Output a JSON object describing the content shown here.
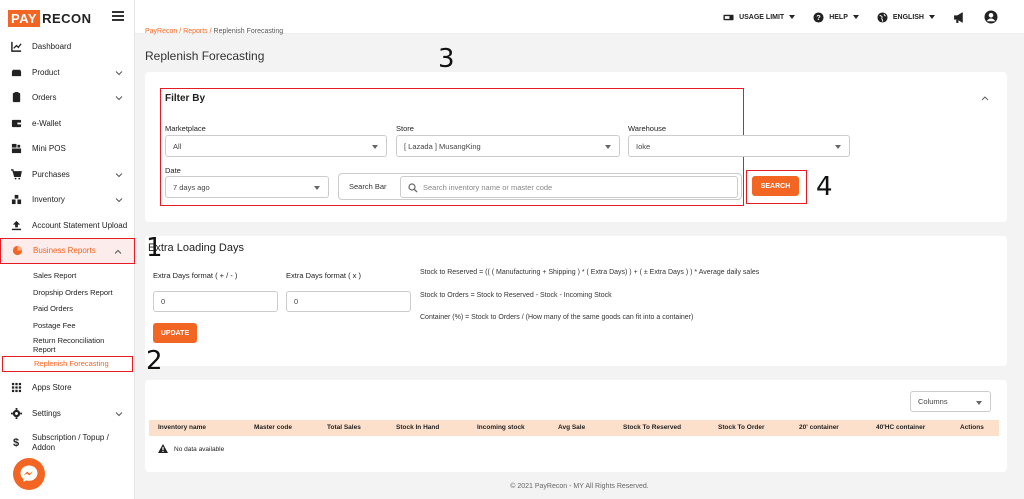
{
  "brand": {
    "logo_part1": "PAY",
    "logo_part2": "RECON"
  },
  "sidebar": {
    "items": [
      {
        "label": "Dashboard",
        "icon": "chart-icon"
      },
      {
        "label": "Product",
        "icon": "product-icon"
      },
      {
        "label": "Orders",
        "icon": "orders-icon"
      },
      {
        "label": "e-Wallet",
        "icon": "wallet-icon"
      },
      {
        "label": "Mini POS",
        "icon": "pos-icon"
      },
      {
        "label": "Purchases",
        "icon": "cart-icon"
      },
      {
        "label": "Inventory",
        "icon": "inventory-icon"
      },
      {
        "label": "Account Statement Upload",
        "icon": "upload-icon"
      },
      {
        "label": "Business Reports",
        "icon": "pie-icon"
      }
    ],
    "sub_items": [
      {
        "label": "Sales Report"
      },
      {
        "label": "Dropship Orders Report"
      },
      {
        "label": "Paid Orders"
      },
      {
        "label": "Postage Fee"
      },
      {
        "label": "Return Reconciliation Report"
      },
      {
        "label": "Replenish Forecasting"
      }
    ],
    "bottom_items": [
      {
        "label": "Apps Store",
        "icon": "grid-icon"
      },
      {
        "label": "Settings",
        "icon": "gear-icon"
      },
      {
        "label": "Subscription / Topup / Addon",
        "icon": "dollar-icon"
      }
    ]
  },
  "topbar": {
    "usage_limit": "USAGE LIMIT",
    "help": "HELP",
    "language": "ENGLISH"
  },
  "breadcrumb": {
    "home": "PayRecon",
    "sep": "/",
    "reports": "Reports",
    "current": "Replenish Forecasting"
  },
  "page_title": "Replenish Forecasting",
  "annotations": {
    "n1": "1",
    "n2": "2",
    "n3": "3",
    "n4": "4"
  },
  "filter": {
    "title": "Filter By",
    "marketplace_label": "Marketplace",
    "marketplace_value": "All",
    "store_label": "Store",
    "store_value": "[ Lazada ] MusangKing",
    "warehouse_label": "Warehouse",
    "warehouse_value": "Ioke",
    "date_label": "Date",
    "date_value": "7 days ago",
    "search_bar_label": "Search Bar",
    "search_placeholder": "Search inventory name or master code",
    "search_button": "SEARCH"
  },
  "extra": {
    "title": "Extra Loading Days",
    "format1_label": "Extra Days format ( + / - )",
    "format1_value": "0",
    "format2_label": "Extra Days format ( x )",
    "format2_value": "0",
    "update_button": "UPDATE",
    "formula1": "Stock to Reserved = (( ( Manufacturing + Shipping ) * ( Extra Days) ) + ( ± Extra Days ) ) * Average daily sales",
    "formula2": "Stock to Orders = Stock to Reserved - Stock - Incoming Stock",
    "formula3": "Container (%) = Stock to Orders / (How many of the same goods can fit into a container)"
  },
  "table": {
    "columns_button": "Columns",
    "headers": [
      "Inventory name",
      "Master code",
      "Total Sales",
      "Stock In Hand",
      "Incoming stock",
      "Avg Sale",
      "Stock To Reserved",
      "Stock To Order",
      "20' container",
      "40'HC container",
      "Actions"
    ],
    "empty_text": "No data available"
  },
  "footer": "© 2021 PayRecon - MY All Rights Reserved.",
  "colors": {
    "accent": "#f26522",
    "annotation_red": "#e51c23",
    "table_head": "#fde0cc"
  }
}
